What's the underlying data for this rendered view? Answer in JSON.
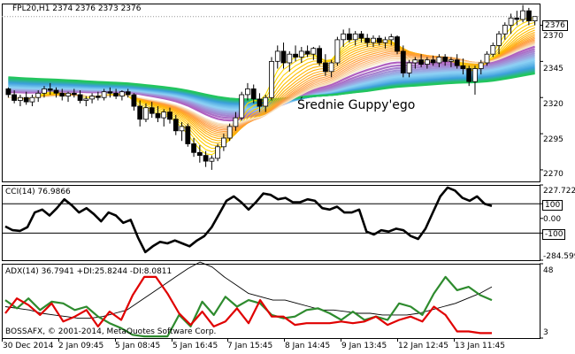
{
  "colors": {
    "background": "#ffffff",
    "frame": "#000000",
    "bull_candle": "#ffffff",
    "bear_candle": "#000000",
    "cci_line": "#000000",
    "adx_line": "#000000",
    "plus_di": "#2e8b2e",
    "minus_di": "#e00000",
    "guppy_short": [
      "#ffe000",
      "#ffb300",
      "#ff9a40",
      "#f5e6c8"
    ],
    "guppy_long": [
      "#b060c0",
      "#8fd3f5",
      "#3b9edc",
      "#22c55e"
    ]
  },
  "chart_data": [
    {
      "type": "candlestick",
      "title": "FPL20,H1  2374 2376 2373 2376",
      "annotation": "Średnie Guppy'ego",
      "y_ticks": [
        "2370",
        "2345",
        "2320",
        "2295",
        "2270"
      ],
      "y_tick_values": [
        2370,
        2345,
        2320,
        2295,
        2270
      ],
      "last_price_tag": "2376",
      "last_price": 2376,
      "ylim": [
        2262,
        2385
      ],
      "candles": [
        [
          2326,
          2327,
          2320,
          2322
        ],
        [
          2322,
          2325,
          2316,
          2318
        ],
        [
          2318,
          2322,
          2314,
          2320
        ],
        [
          2320,
          2324,
          2315,
          2317
        ],
        [
          2317,
          2322,
          2314,
          2320
        ],
        [
          2320,
          2325,
          2317,
          2323
        ],
        [
          2323,
          2328,
          2320,
          2326
        ],
        [
          2326,
          2330,
          2322,
          2325
        ],
        [
          2325,
          2327,
          2320,
          2323
        ],
        [
          2323,
          2326,
          2318,
          2321
        ],
        [
          2321,
          2324,
          2317,
          2323
        ],
        [
          2323,
          2326,
          2320,
          2322
        ],
        [
          2322,
          2325,
          2316,
          2318
        ],
        [
          2318,
          2321,
          2314,
          2319
        ],
        [
          2319,
          2323,
          2316,
          2321
        ],
        [
          2321,
          2324,
          2318,
          2320
        ],
        [
          2320,
          2326,
          2318,
          2324
        ],
        [
          2324,
          2327,
          2320,
          2323
        ],
        [
          2323,
          2326,
          2319,
          2321
        ],
        [
          2321,
          2325,
          2318,
          2324
        ],
        [
          2324,
          2326,
          2320,
          2322
        ],
        [
          2322,
          2323,
          2311,
          2314
        ],
        [
          2314,
          2318,
          2300,
          2305
        ],
        [
          2305,
          2316,
          2303,
          2313
        ],
        [
          2313,
          2317,
          2306,
          2309
        ],
        [
          2309,
          2314,
          2303,
          2306
        ],
        [
          2306,
          2312,
          2300,
          2310
        ],
        [
          2310,
          2313,
          2302,
          2305
        ],
        [
          2305,
          2308,
          2294,
          2297
        ],
        [
          2297,
          2303,
          2290,
          2300
        ],
        [
          2300,
          2302,
          2286,
          2288
        ],
        [
          2288,
          2292,
          2279,
          2282
        ],
        [
          2282,
          2287,
          2275,
          2280
        ],
        [
          2280,
          2283,
          2272,
          2276
        ],
        [
          2276,
          2280,
          2270,
          2278
        ],
        [
          2278,
          2288,
          2276,
          2286
        ],
        [
          2286,
          2295,
          2283,
          2292
        ],
        [
          2292,
          2302,
          2290,
          2300
        ],
        [
          2300,
          2310,
          2297,
          2306
        ],
        [
          2306,
          2324,
          2304,
          2322
        ],
        [
          2322,
          2330,
          2318,
          2326
        ],
        [
          2326,
          2329,
          2316,
          2319
        ],
        [
          2319,
          2323,
          2310,
          2314
        ],
        [
          2314,
          2322,
          2310,
          2320
        ],
        [
          2320,
          2348,
          2318,
          2345
        ],
        [
          2345,
          2356,
          2340,
          2352
        ],
        [
          2352,
          2358,
          2340,
          2344
        ],
        [
          2344,
          2352,
          2338,
          2350
        ],
        [
          2350,
          2356,
          2345,
          2348
        ],
        [
          2348,
          2355,
          2344,
          2352
        ],
        [
          2352,
          2356,
          2348,
          2350
        ],
        [
          2350,
          2355,
          2346,
          2354
        ],
        [
          2354,
          2356,
          2342,
          2344
        ],
        [
          2344,
          2350,
          2335,
          2338
        ],
        [
          2338,
          2346,
          2334,
          2344
        ],
        [
          2344,
          2362,
          2342,
          2360
        ],
        [
          2360,
          2367,
          2355,
          2364
        ],
        [
          2364,
          2368,
          2358,
          2360
        ],
        [
          2360,
          2366,
          2356,
          2364
        ],
        [
          2364,
          2366,
          2358,
          2361
        ],
        [
          2361,
          2364,
          2355,
          2358
        ],
        [
          2358,
          2363,
          2355,
          2361
        ],
        [
          2361,
          2363,
          2356,
          2358
        ],
        [
          2358,
          2362,
          2354,
          2360
        ],
        [
          2360,
          2364,
          2356,
          2362
        ],
        [
          2362,
          2363,
          2350,
          2352
        ],
        [
          2352,
          2356,
          2334,
          2337
        ],
        [
          2337,
          2346,
          2334,
          2344
        ],
        [
          2344,
          2348,
          2340,
          2346
        ],
        [
          2346,
          2350,
          2341,
          2343
        ],
        [
          2343,
          2348,
          2340,
          2346
        ],
        [
          2346,
          2349,
          2342,
          2344
        ],
        [
          2344,
          2350,
          2341,
          2348
        ],
        [
          2348,
          2350,
          2342,
          2345
        ],
        [
          2345,
          2348,
          2341,
          2346
        ],
        [
          2346,
          2350,
          2340,
          2342
        ],
        [
          2342,
          2347,
          2336,
          2340
        ],
        [
          2340,
          2342,
          2328,
          2331
        ],
        [
          2331,
          2342,
          2322,
          2340
        ],
        [
          2340,
          2346,
          2336,
          2344
        ],
        [
          2344,
          2352,
          2342,
          2350
        ],
        [
          2350,
          2358,
          2348,
          2356
        ],
        [
          2356,
          2366,
          2350,
          2364
        ],
        [
          2364,
          2372,
          2360,
          2370
        ],
        [
          2370,
          2378,
          2364,
          2375
        ],
        [
          2375,
          2380,
          2370,
          2374
        ],
        [
          2374,
          2384,
          2372,
          2380
        ],
        [
          2380,
          2382,
          2370,
          2373
        ],
        [
          2373,
          2376,
          2370,
          2376
        ]
      ]
    },
    {
      "type": "line",
      "title": "CCI(14) 76.9866",
      "y_ticks": [
        "227.7225",
        "100",
        "0.00",
        "-100",
        "-284.599"
      ],
      "y_tick_values": [
        227.72,
        100,
        0,
        -100,
        -284.6
      ],
      "tagged_levels": [
        100,
        -100
      ],
      "ylim": [
        -284.6,
        227.72
      ],
      "series": [
        {
          "name": "CCI(14)",
          "values": [
            -55,
            -80,
            -85,
            -60,
            40,
            60,
            20,
            70,
            130,
            90,
            40,
            70,
            30,
            -20,
            40,
            20,
            -30,
            -10,
            -130,
            -230,
            -190,
            -160,
            -170,
            -150,
            -170,
            -190,
            -150,
            -120,
            -60,
            30,
            120,
            150,
            110,
            60,
            110,
            170,
            160,
            130,
            140,
            110,
            110,
            130,
            120,
            70,
            60,
            80,
            40,
            40,
            60,
            -90,
            -110,
            -80,
            -90,
            -70,
            -80,
            -120,
            -140,
            -70,
            40,
            150,
            210,
            190,
            140,
            120,
            150,
            100,
            85
          ]
        }
      ]
    },
    {
      "type": "line",
      "title": "ADX(14) 36.7941 +DI:25.8244 -DI:8.0811",
      "y_ticks": [
        "48",
        "3"
      ],
      "y_tick_values": [
        48,
        3
      ],
      "ylim": [
        3,
        48
      ],
      "footer": "BOSSAFX, © 2001-2014, MetaQuotes Software Corp.",
      "series": [
        {
          "name": "ADX(14)",
          "values": [
            22,
            21,
            20,
            18,
            17,
            16,
            15,
            15,
            16,
            18,
            20,
            25,
            30,
            35,
            40,
            45,
            49,
            46,
            40,
            35,
            30,
            28,
            26,
            26,
            24,
            22,
            20,
            20,
            19,
            18,
            18,
            17,
            17,
            17,
            18,
            20,
            22,
            24,
            27,
            30,
            34
          ]
        },
        {
          "name": "+DI",
          "values": [
            26,
            21,
            27,
            20,
            25,
            24,
            20,
            22,
            16,
            12,
            9,
            5,
            4,
            4,
            4,
            17,
            10,
            25,
            17,
            28,
            22,
            26,
            24,
            17,
            15,
            16,
            20,
            21,
            18,
            14,
            19,
            14,
            16,
            14,
            24,
            22,
            17,
            30,
            40,
            32,
            34,
            29,
            26
          ]
        },
        {
          "name": "-DI",
          "values": [
            18,
            27,
            23,
            17,
            24,
            13,
            16,
            20,
            10,
            19,
            14,
            29,
            40,
            40,
            30,
            18,
            11,
            19,
            10,
            13,
            21,
            12,
            26,
            16,
            16,
            11,
            12,
            12,
            12,
            13,
            12,
            13,
            16,
            11,
            14,
            16,
            13,
            22,
            17,
            7,
            7,
            6,
            6
          ]
        }
      ]
    }
  ],
  "x_axis_labels": [
    "30 Dec 2014",
    "2 Jan 09:45",
    "5 Jan 08:45",
    "5 Jan 16:45",
    "7 Jan 15:45",
    "8 Jan 14:45",
    "9 Jan 13:45",
    "12 Jan 12:45",
    "13 Jan 11:45"
  ]
}
